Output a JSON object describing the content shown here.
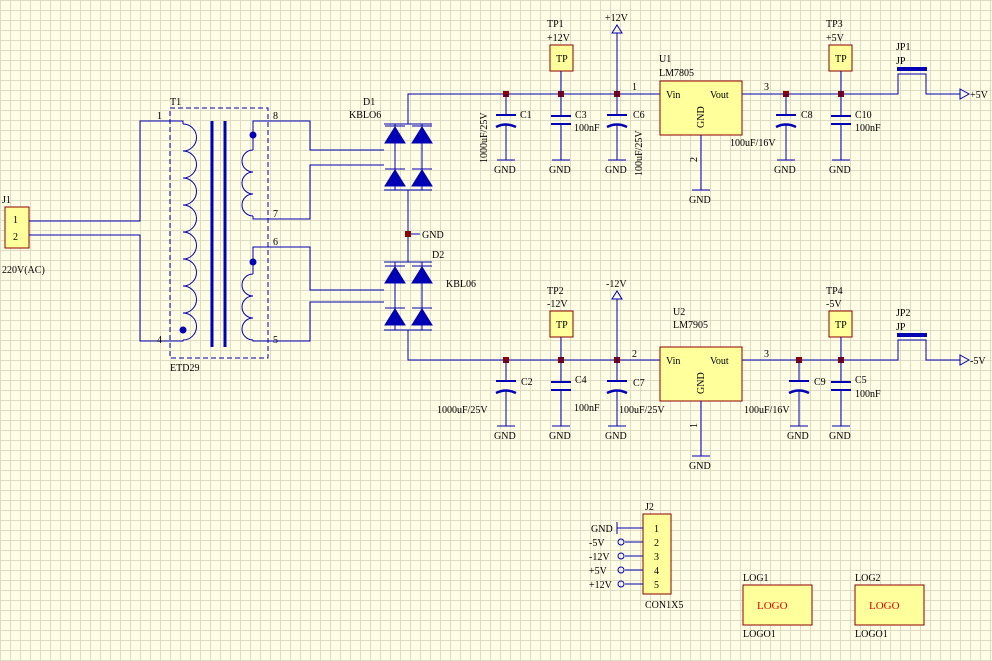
{
  "components": {
    "J1": {
      "ref": "J1",
      "pin1": "1",
      "pin2": "2",
      "label": "220V(AC)"
    },
    "T1": {
      "ref": "T1",
      "value": "ETD29",
      "pin1": "1",
      "pin4": "4",
      "pin8": "8",
      "pin7": "7",
      "pin6": "6",
      "pin5": "5"
    },
    "D1": {
      "ref": "D1",
      "value": "KBLO6"
    },
    "D2": {
      "ref": "D2",
      "value": "KBL06"
    },
    "U1": {
      "ref": "U1",
      "value": "LM7805",
      "vin": "Vin",
      "vout": "Vout",
      "gnd": "GND",
      "p1": "1",
      "p2": "2",
      "p3": "3"
    },
    "U2": {
      "ref": "U2",
      "value": "LM7905",
      "vin": "Vin",
      "vout": "Vout",
      "gnd": "GND",
      "p1": "1",
      "p2": "2",
      "p3": "3"
    },
    "C1": {
      "ref": "C1",
      "value": "1000uF/25V"
    },
    "C2": {
      "ref": "C2",
      "value": "1000uF/25V"
    },
    "C3": {
      "ref": "C3",
      "value": "100nF"
    },
    "C4": {
      "ref": "C4",
      "value": "100nF"
    },
    "C5": {
      "ref": "C5",
      "value": "100nF"
    },
    "C6": {
      "ref": "C6",
      "value": "100uF/25V"
    },
    "C7": {
      "ref": "C7",
      "value": "100uF/25V"
    },
    "C8": {
      "ref": "C8",
      "value": "100uF/16V"
    },
    "C9": {
      "ref": "C9",
      "value": "100uF/16V"
    },
    "C10": {
      "ref": "C10",
      "value": "100nF"
    },
    "TP1": {
      "ref": "TP1",
      "net": "+12V",
      "body": "TP"
    },
    "TP2": {
      "ref": "TP2",
      "net": "-12V",
      "body": "TP"
    },
    "TP3": {
      "ref": "TP3",
      "net": "+5V",
      "body": "TP"
    },
    "TP4": {
      "ref": "TP4",
      "net": "-5V",
      "body": "TP"
    },
    "JP1": {
      "ref": "JP1",
      "value": "JP"
    },
    "JP2": {
      "ref": "JP2",
      "value": "JP"
    },
    "J2": {
      "ref": "J2",
      "value": "CON1X5",
      "pins": [
        "1",
        "2",
        "3",
        "4",
        "5"
      ],
      "nets": [
        "GND",
        "-5V",
        "-12V",
        "+5V",
        "+12V"
      ]
    },
    "LOG1": {
      "ref": "LOG1",
      "text": "LOGO",
      "value": "LOGO1"
    },
    "LOG2": {
      "ref": "LOG2",
      "text": "LOGO",
      "value": "LOGO1"
    }
  },
  "nets": {
    "gnd": "GND",
    "p12": "+12V",
    "n12": "-12V",
    "p5": "+5V",
    "n5": "-5V"
  },
  "colors": {
    "wire": "#0000b4",
    "component_outline": "#8b0000",
    "component_fill": "#ffff9c",
    "logo_text": "#e00000",
    "background": "#fffde6"
  }
}
